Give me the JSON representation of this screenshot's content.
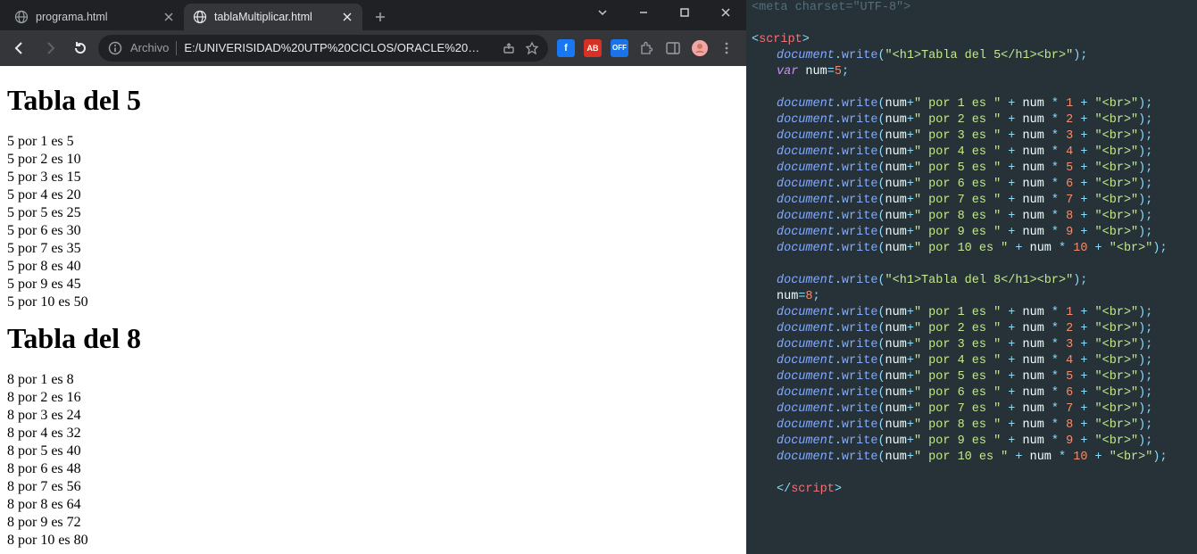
{
  "browser": {
    "tabs": [
      {
        "title": "programa.html",
        "active": false
      },
      {
        "title": "tablaMultiplicar.html",
        "active": true
      }
    ],
    "newtab_label": "+",
    "window_controls": {
      "dropdown": "∨",
      "min": "—",
      "max": "☐",
      "close": "✕"
    },
    "toolbar": {
      "back": "←",
      "forward": "→",
      "reload": "↻",
      "scheme": "Archivo",
      "url": "E:/UNIVERISIDAD%20UTP%20CICLOS/ORACLE%20…",
      "share": "↗",
      "star": "☆",
      "menu": "⋮"
    },
    "extensions": {
      "fb": "f",
      "ab": "AB",
      "off": "OFF",
      "puzzle": "🧩",
      "panel": "▢"
    }
  },
  "page": {
    "h1a": "Tabla del 5",
    "lines5": [
      "5 por 1 es 5",
      "5 por 2 es 10",
      "5 por 3 es 15",
      "5 por 4 es 20",
      "5 por 5 es 25",
      "5 por 6 es 30",
      "5 por 7 es 35",
      "5 por 8 es 40",
      "5 por 9 es 45",
      "5 por 10 es 50"
    ],
    "h1b": "Tabla del 8",
    "lines8": [
      "8 por 1 es 8",
      "8 por 2 es 16",
      "8 por 3 es 24",
      "8 por 4 es 32",
      "8 por 5 es 40",
      "8 por 6 es 48",
      "8 por 7 es 56",
      "8 por 8 es 64",
      "8 por 9 es 72",
      "8 por 10 es 80"
    ]
  },
  "code": {
    "meta_open": "<",
    "meta_name": "meta",
    "meta_attr": " charset",
    "meta_eq": "=",
    "meta_val": "\"UTF-8\"",
    "meta_close": ">",
    "script_open": "<",
    "script_name": "script",
    "script_close": ">",
    "doc": "document",
    "dot": ".",
    "write": "write",
    "lp": "(",
    "rp": ")",
    "semi": ";",
    "plus": " + ",
    "star": " * ",
    "numvar": "num",
    "eq": "=",
    "var_kw": "var",
    "h5_str": "\"<h1>Tabla del 5</h1><br>\"",
    "h8_str": "\"<h1>Tabla del 8</h1><br>\"",
    "num5": "5",
    "num8": "8",
    "por_pre": "\" por ",
    "es_sfx": " es \"",
    "br_str": "\"<br>\"",
    "close_open": "</",
    "nums": [
      "1",
      "2",
      "3",
      "4",
      "5",
      "6",
      "7",
      "8",
      "9",
      "10"
    ]
  }
}
